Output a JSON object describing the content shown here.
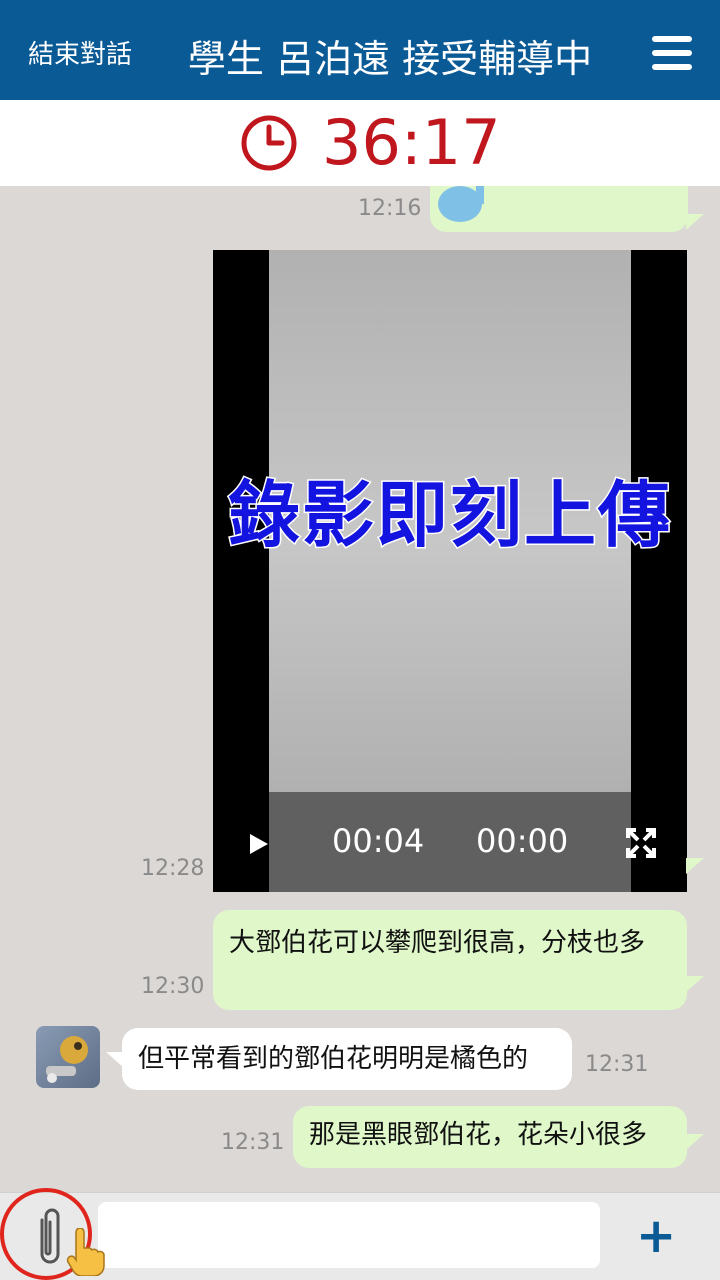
{
  "header": {
    "end_label": "結束對話",
    "title": "學生 呂泊遠 接受輔導中"
  },
  "timer": {
    "value": "36:17"
  },
  "messages": [
    {
      "time": "12:16"
    },
    {
      "time": "12:28",
      "overlay": "錄影即刻上傳",
      "elapsed": "00:04",
      "remaining": "00:00"
    },
    {
      "time": "12:30",
      "text": "大鄧伯花可以攀爬到很高，分枝也多"
    },
    {
      "time": "12:31",
      "text": "但平常看到的鄧伯花明明是橘色的"
    },
    {
      "time": "12:31",
      "text": "那是黑眼鄧伯花，花朵小很多"
    }
  ],
  "composer": {
    "placeholder": "",
    "send_label": "+"
  },
  "colors": {
    "header": "#0a5a96",
    "timer": "#c0161e",
    "bubble_out": "#dff7c9",
    "highlight": "#e0251d"
  }
}
